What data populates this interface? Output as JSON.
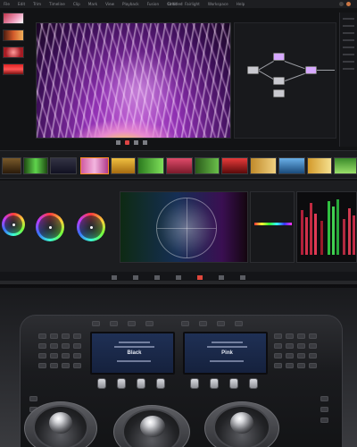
{
  "app": {
    "menu": [
      "File",
      "Edit",
      "Trim",
      "Timeline",
      "Clip",
      "Mark",
      "View",
      "Playback",
      "Fusion",
      "Color",
      "Fairlight",
      "Workspace",
      "Help"
    ],
    "project_title": "Untitled"
  },
  "colors": {
    "accent": "#ff8c26",
    "active_page": "#e0473c",
    "node_selected": "#d7a9ff"
  },
  "viewer": {
    "description_icon": "flower-macro-image"
  },
  "panel": {
    "lcd_left": "Black",
    "lcd_right": "Pink"
  }
}
